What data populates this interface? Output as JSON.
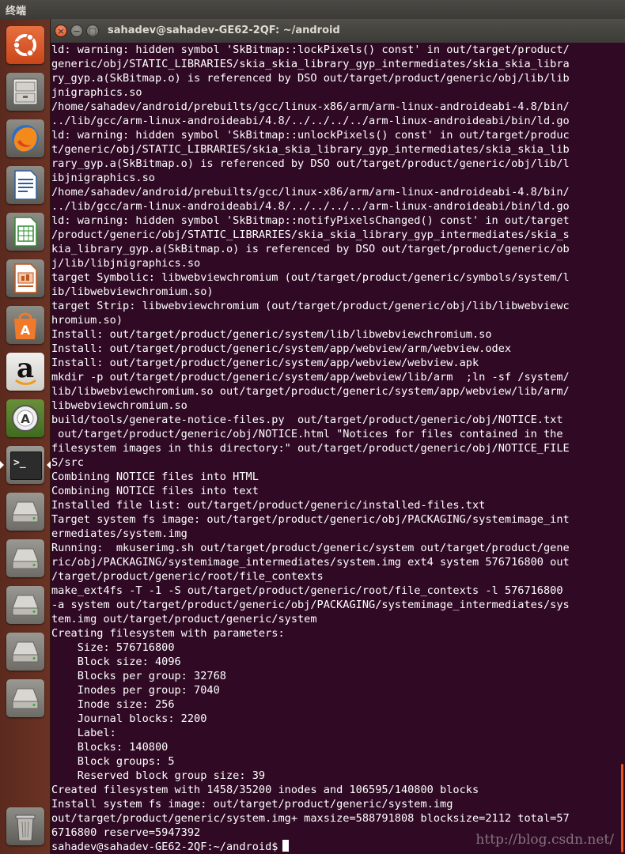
{
  "topbar": {
    "app_name": "终端"
  },
  "launcher": {
    "items": [
      {
        "name": "Dash",
        "icon": "ubuntu-logo-icon"
      },
      {
        "name": "Files",
        "icon": "file-cabinet-icon"
      },
      {
        "name": "Firefox",
        "icon": "firefox-icon"
      },
      {
        "name": "LibreOffice Writer",
        "icon": "writer-icon"
      },
      {
        "name": "LibreOffice Calc",
        "icon": "calc-icon"
      },
      {
        "name": "LibreOffice Impress",
        "icon": "impress-icon"
      },
      {
        "name": "Ubuntu Software Center",
        "icon": "software-center-icon"
      },
      {
        "name": "Amazon",
        "icon": "amazon-icon",
        "letter": "a"
      },
      {
        "name": "Software Updater",
        "icon": "software-updater-icon"
      },
      {
        "name": "Terminal",
        "icon": "terminal-icon",
        "prompt": ">_"
      },
      {
        "name": "Drive 1",
        "icon": "hard-drive-icon"
      },
      {
        "name": "Drive 2",
        "icon": "hard-drive-icon"
      },
      {
        "name": "Drive 3",
        "icon": "hard-drive-icon"
      },
      {
        "name": "Drive 4",
        "icon": "hard-drive-icon"
      },
      {
        "name": "Drive 5",
        "icon": "hard-drive-icon"
      },
      {
        "name": "Trash",
        "icon": "trash-icon"
      }
    ]
  },
  "window": {
    "title": "sahadev@sahadev-GE62-2QF: ~/android",
    "close_glyph": "×",
    "minimize_glyph": "−",
    "maximize_glyph": "□"
  },
  "terminal": {
    "lines": [
      "ld: warning: hidden symbol 'SkBitmap::lockPixels() const' in out/target/product/",
      "generic/obj/STATIC_LIBRARIES/skia_skia_library_gyp_intermediates/skia_skia_libra",
      "ry_gyp.a(SkBitmap.o) is referenced by DSO out/target/product/generic/obj/lib/lib",
      "jnigraphics.so",
      "/home/sahadev/android/prebuilts/gcc/linux-x86/arm/arm-linux-androideabi-4.8/bin/",
      "../lib/gcc/arm-linux-androideabi/4.8/../../../../arm-linux-androideabi/bin/ld.go",
      "ld: warning: hidden symbol 'SkBitmap::unlockPixels() const' in out/target/produc",
      "t/generic/obj/STATIC_LIBRARIES/skia_skia_library_gyp_intermediates/skia_skia_lib",
      "rary_gyp.a(SkBitmap.o) is referenced by DSO out/target/product/generic/obj/lib/l",
      "ibjnigraphics.so",
      "/home/sahadev/android/prebuilts/gcc/linux-x86/arm/arm-linux-androideabi-4.8/bin/",
      "../lib/gcc/arm-linux-androideabi/4.8/../../../../arm-linux-androideabi/bin/ld.go",
      "ld: warning: hidden symbol 'SkBitmap::notifyPixelsChanged() const' in out/target",
      "/product/generic/obj/STATIC_LIBRARIES/skia_skia_library_gyp_intermediates/skia_s",
      "kia_library_gyp.a(SkBitmap.o) is referenced by DSO out/target/product/generic/ob",
      "j/lib/libjnigraphics.so",
      "target Symbolic: libwebviewchromium (out/target/product/generic/symbols/system/l",
      "ib/libwebviewchromium.so)",
      "target Strip: libwebviewchromium (out/target/product/generic/obj/lib/libwebviewc",
      "hromium.so)",
      "Install: out/target/product/generic/system/lib/libwebviewchromium.so",
      "Install: out/target/product/generic/system/app/webview/arm/webview.odex",
      "Install: out/target/product/generic/system/app/webview/webview.apk",
      "mkdir -p out/target/product/generic/system/app/webview/lib/arm  ;ln -sf /system/",
      "lib/libwebviewchromium.so out/target/product/generic/system/app/webview/lib/arm/",
      "libwebviewchromium.so",
      "build/tools/generate-notice-files.py  out/target/product/generic/obj/NOTICE.txt",
      " out/target/product/generic/obj/NOTICE.html \"Notices for files contained in the",
      "filesystem images in this directory:\" out/target/product/generic/obj/NOTICE_FILE",
      "S/src",
      "Combining NOTICE files into HTML",
      "Combining NOTICE files into text",
      "Installed file list: out/target/product/generic/installed-files.txt",
      "Target system fs image: out/target/product/generic/obj/PACKAGING/systemimage_int",
      "ermediates/system.img",
      "Running:  mkuserimg.sh out/target/product/generic/system out/target/product/gene",
      "ric/obj/PACKAGING/systemimage_intermediates/system.img ext4 system 576716800 out",
      "/target/product/generic/root/file_contexts",
      "make_ext4fs -T -1 -S out/target/product/generic/root/file_contexts -l 576716800",
      "-a system out/target/product/generic/obj/PACKAGING/systemimage_intermediates/sys",
      "tem.img out/target/product/generic/system",
      "Creating filesystem with parameters:",
      "    Size: 576716800",
      "    Block size: 4096",
      "    Blocks per group: 32768",
      "    Inodes per group: 7040",
      "    Inode size: 256",
      "    Journal blocks: 2200",
      "    Label:",
      "    Blocks: 140800",
      "    Block groups: 5",
      "    Reserved block group size: 39",
      "Created filesystem with 1458/35200 inodes and 106595/140800 blocks",
      "Install system fs image: out/target/product/generic/system.img",
      "out/target/product/generic/system.img+ maxsize=588791808 blocksize=2112 total=57",
      "6716800 reserve=5947392"
    ],
    "prompt": "sahadev@sahadev-GE62-2QF:~/android$"
  },
  "watermark": "http://blog.csdn.net/"
}
